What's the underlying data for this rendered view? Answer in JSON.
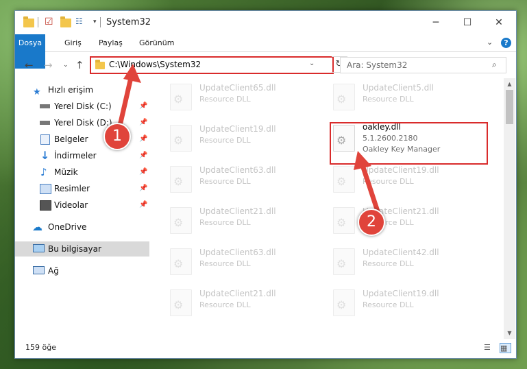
{
  "window": {
    "title": "System32"
  },
  "ribbon": {
    "tabs": [
      "Dosya",
      "Giriş",
      "Paylaş",
      "Görünüm"
    ]
  },
  "nav": {
    "address": "C:\\Windows\\System32",
    "search_placeholder": "Ara: System32"
  },
  "sidebar": {
    "items": [
      {
        "label": "Hızlı erişim",
        "icon": "star-icon"
      },
      {
        "label": "Yerel Disk (C:)",
        "icon": "drive-icon",
        "pinned": true
      },
      {
        "label": "Yerel Disk (D:)",
        "icon": "drive-icon",
        "pinned": true
      },
      {
        "label": "Belgeler",
        "icon": "documents-icon",
        "pinned": true
      },
      {
        "label": "İndirmeler",
        "icon": "downloads-icon",
        "pinned": true
      },
      {
        "label": "Müzik",
        "icon": "music-icon",
        "pinned": true
      },
      {
        "label": "Resimler",
        "icon": "pictures-icon",
        "pinned": true
      },
      {
        "label": "Videolar",
        "icon": "videos-icon",
        "pinned": true
      },
      {
        "label": "OneDrive",
        "icon": "cloud-icon"
      },
      {
        "label": "Bu bilgisayar",
        "icon": "computer-icon",
        "selected": true
      },
      {
        "label": "Ağ",
        "icon": "network-icon"
      }
    ]
  },
  "files": [
    {
      "name": "UpdateClient65.dll",
      "desc": "Resource DLL"
    },
    {
      "name": "UpdateClient5.dll",
      "desc": "Resource DLL"
    },
    {
      "name": "UpdateClient19.dll",
      "desc": "Resource DLL"
    },
    {
      "name": "oakley.dll",
      "version": "5.1.2600.2180",
      "desc": "Oakley Key Manager",
      "active": true
    },
    {
      "name": "UpdateClient63.dll",
      "desc": "Resource DLL"
    },
    {
      "name": "UpdateClient19.dll",
      "desc": "Resource DLL"
    },
    {
      "name": "UpdateClient21.dll",
      "desc": "Resource DLL"
    },
    {
      "name": "UpdateClient21.dll",
      "desc": "Resource DLL"
    },
    {
      "name": "UpdateClient63.dll",
      "desc": "Resource DLL"
    },
    {
      "name": "UpdateClient42.dll",
      "desc": "Resource DLL"
    },
    {
      "name": "UpdateClient21.dll",
      "desc": "Resource DLL"
    },
    {
      "name": "UpdateClient19.dll",
      "desc": "Resource DLL"
    }
  ],
  "status": {
    "item_count": "159 öğe"
  },
  "callouts": [
    "1",
    "2"
  ],
  "colors": {
    "accent": "#1979ca",
    "highlight": "#d92b2b",
    "badge": "#e0443b"
  }
}
